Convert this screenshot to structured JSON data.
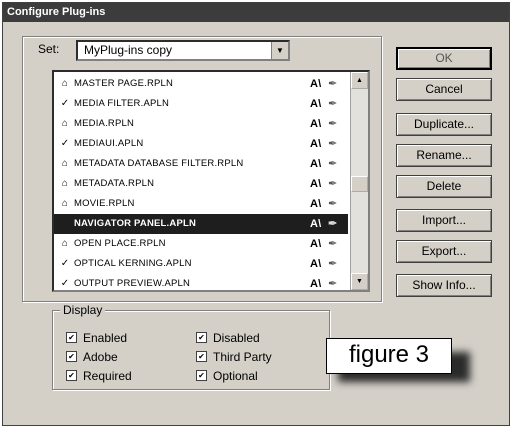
{
  "window": {
    "title": "Configure Plug-ins"
  },
  "set": {
    "label": "Set:",
    "value": "MyPlug-ins copy"
  },
  "plugins": [
    {
      "mark": "lock",
      "name": "MASTER PAGE.RPLN"
    },
    {
      "mark": "check",
      "name": "MEDIA FILTER.APLN"
    },
    {
      "mark": "lock",
      "name": "MEDIA.RPLN"
    },
    {
      "mark": "check",
      "name": "MEDIAUI.APLN"
    },
    {
      "mark": "lock",
      "name": "METADATA DATABASE FILTER.RPLN"
    },
    {
      "mark": "lock",
      "name": "METADATA.RPLN"
    },
    {
      "mark": "lock",
      "name": "MOVIE.RPLN"
    },
    {
      "mark": "none",
      "name": "NAVIGATOR PANEL.APLN",
      "selected": true
    },
    {
      "mark": "lock",
      "name": "OPEN PLACE.RPLN"
    },
    {
      "mark": "check",
      "name": "OPTICAL KERNING.APLN"
    },
    {
      "mark": "check",
      "name": "OUTPUT PREVIEW.APLN"
    }
  ],
  "display": {
    "label": "Display",
    "options": {
      "enabled": {
        "label": "Enabled",
        "checked": true
      },
      "disabled": {
        "label": "Disabled",
        "checked": true
      },
      "adobe": {
        "label": "Adobe",
        "checked": true
      },
      "third_party": {
        "label": "Third Party",
        "checked": true
      },
      "required": {
        "label": "Required",
        "checked": true
      },
      "optional": {
        "label": "Optional",
        "checked": true
      }
    }
  },
  "buttons": {
    "ok": "OK",
    "cancel": "Cancel",
    "duplicate": "Duplicate...",
    "rename": "Rename...",
    "delete": "Delete",
    "import": "Import...",
    "export": "Export...",
    "show_info": "Show Info..."
  },
  "figure_caption": "figure 3"
}
